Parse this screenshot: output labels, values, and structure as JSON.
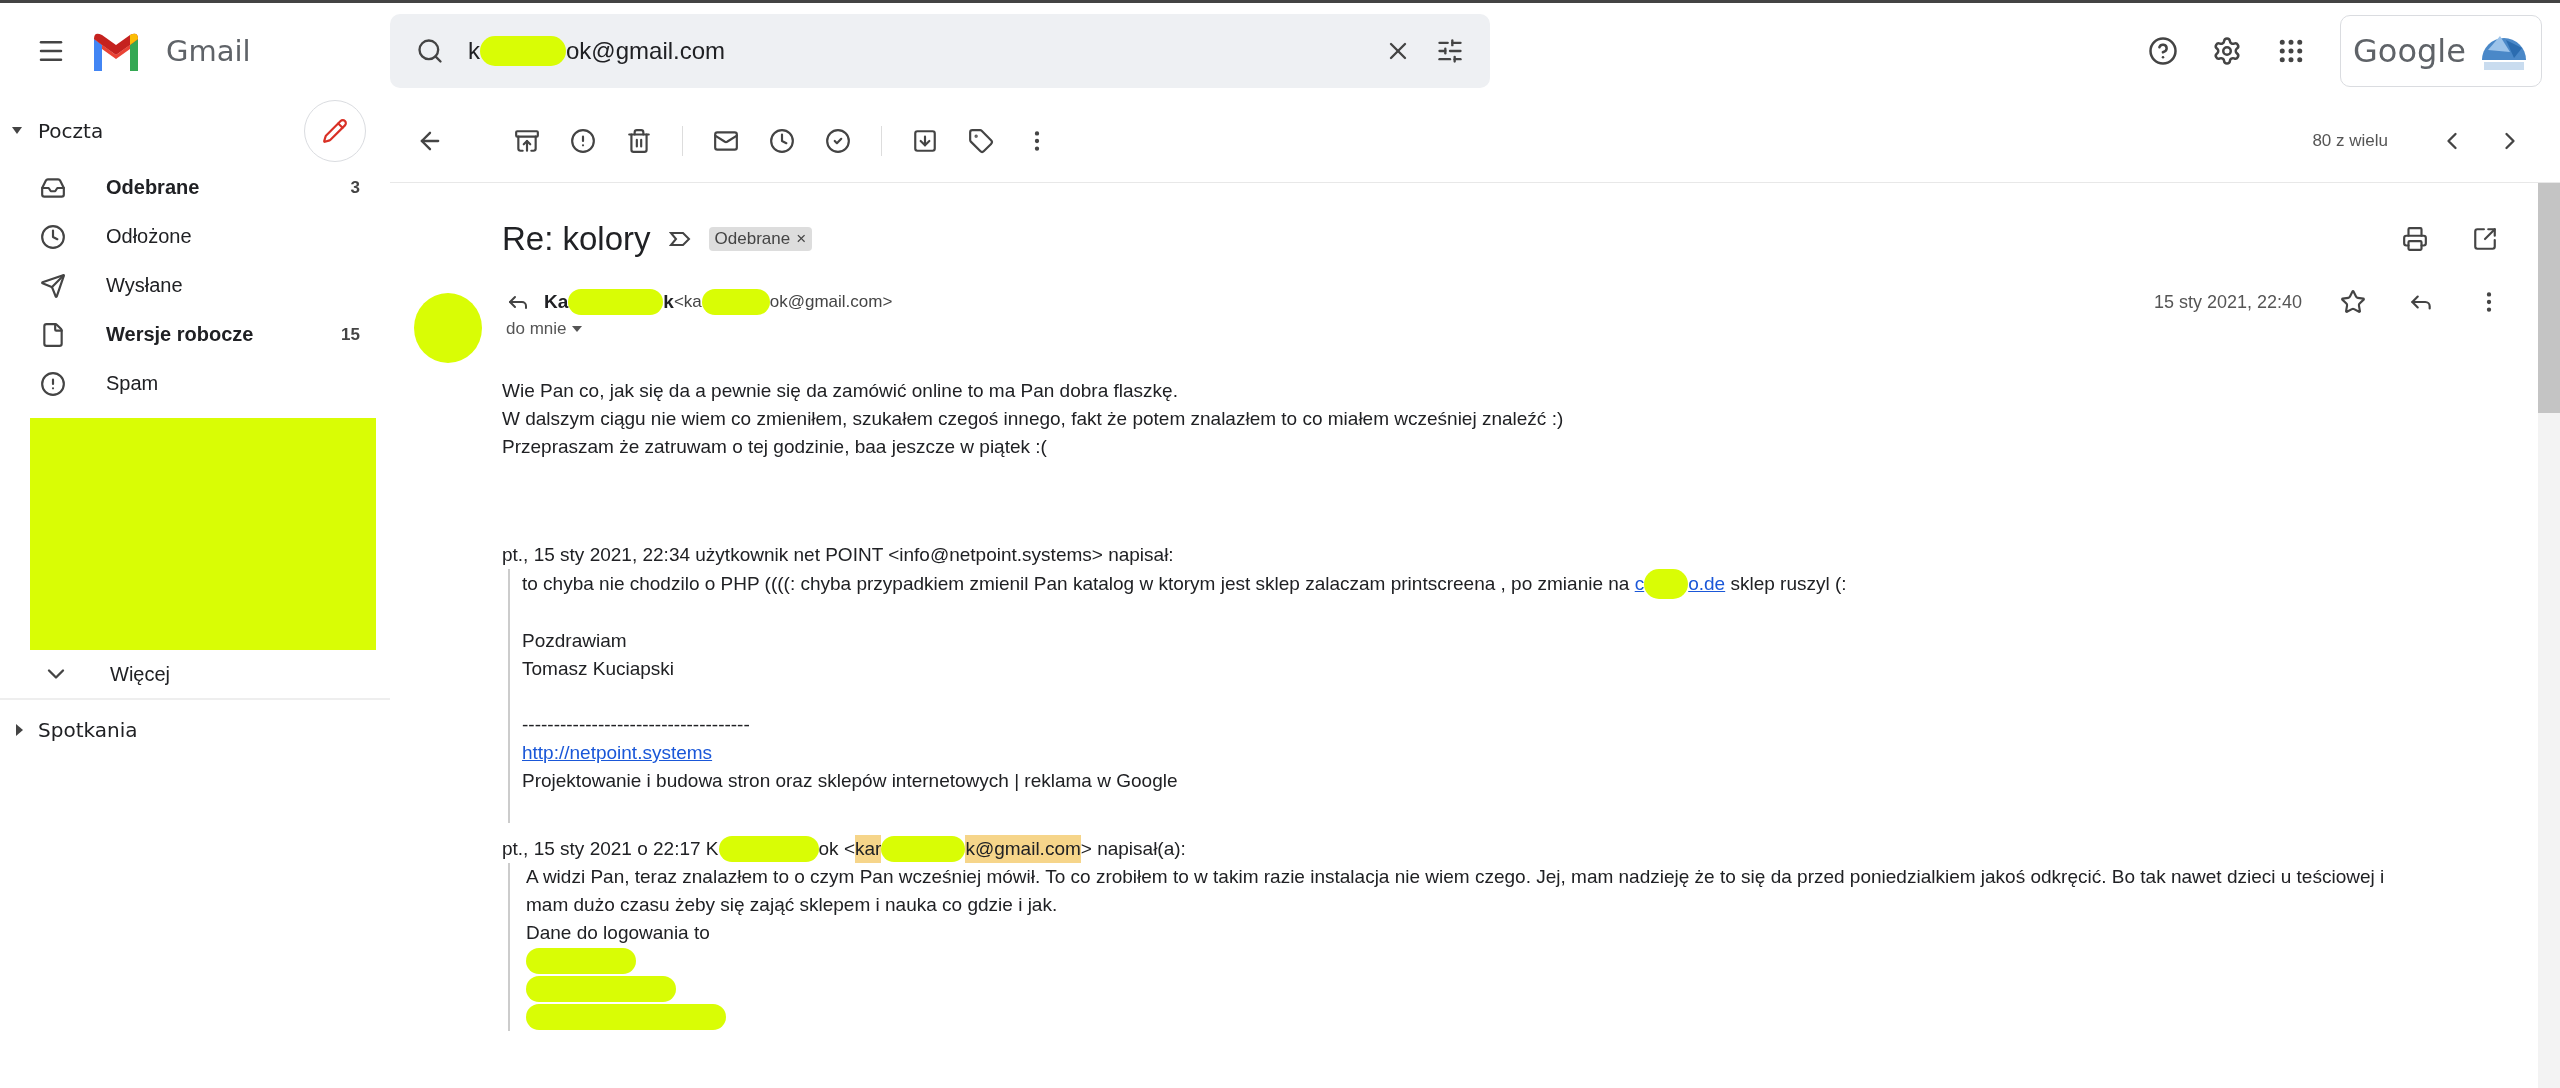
{
  "app": {
    "name": "Gmail"
  },
  "search": {
    "value": [
      {
        "kind": "text",
        "text": "k"
      },
      {
        "kind": "redacted"
      },
      {
        "kind": "text",
        "text": "ok@gmail.com"
      }
    ]
  },
  "account": {
    "label": "Google"
  },
  "sidebar": {
    "section": "Poczta",
    "items": [
      {
        "label": "Odebrane",
        "count": "3",
        "bold": true
      },
      {
        "label": "Odłożone",
        "bold": false
      },
      {
        "label": "Wysłane",
        "bold": false
      },
      {
        "label": "Wersje robocze",
        "count": "15",
        "bold": true
      },
      {
        "label": "Spam",
        "bold": false
      }
    ],
    "more": "Więcej",
    "meetings": "Spotkania"
  },
  "toolbar": {
    "counter": "80 z wielu"
  },
  "message": {
    "subject": "Re: kolory",
    "chip": "Odebrane",
    "chip_close": "×",
    "sender": [
      {
        "kind": "bold",
        "text": "Ka"
      },
      {
        "kind": "redacted"
      },
      {
        "kind": "bold",
        "text": "k"
      },
      {
        "kind": "small",
        "text": " <ka"
      },
      {
        "kind": "redacted"
      },
      {
        "kind": "small",
        "text": "ok@gmail.com>"
      }
    ],
    "recipient": "do mnie",
    "date": "15 sty 2021, 22:40",
    "body": [
      "Wie Pan co, jak się da a pewnie się da zamówić online to ma Pan dobra flaszkę.",
      "W dalszym ciągu nie wiem co zmieniłem, szukałem czegoś innego, fakt że potem znalazłem to co miałem wcześniej znaleźć :)",
      "Przepraszam że zatruwam o tej godzinie, baa jeszcze w piątek :("
    ],
    "quotes": [
      {
        "header": [
          {
            "kind": "text",
            "text": "pt., 15 sty 2021, 22:34 użytkownik net POINT <info@netpoint.systems> napisał:"
          }
        ],
        "lines": [
          [
            {
              "kind": "text",
              "text": "to chyba nie chodzilo o PHP ((((: chyba przypadkiem zmienil Pan katalog w ktorym jest sklep zalaczam printscreena , po zmianie na "
            },
            {
              "kind": "link",
              "text": "c"
            },
            {
              "kind": "redacted"
            },
            {
              "kind": "link",
              "text": "o.de"
            },
            {
              "kind": "text",
              "text": " sklep ruszyl (:"
            }
          ],
          [
            {
              "kind": "gap"
            }
          ],
          [
            {
              "kind": "text",
              "text": "Pozdrawiam"
            }
          ],
          [
            {
              "kind": "text",
              "text": "Tomasz Kuciapski"
            }
          ],
          [
            {
              "kind": "gap"
            }
          ],
          [
            {
              "kind": "text",
              "text": "------------------------------------"
            }
          ],
          [
            {
              "kind": "link",
              "text": "http://netpoint.systems"
            }
          ],
          [
            {
              "kind": "text",
              "text": "Projektowanie i budowa stron oraz sklepów internetowych | reklama w Google"
            }
          ],
          [
            {
              "kind": "gap"
            }
          ]
        ]
      },
      {
        "header": [
          {
            "kind": "text",
            "text": "pt., 15 sty 2021 o 22:17 K"
          },
          {
            "kind": "redacted"
          },
          {
            "kind": "text",
            "text": "ok <"
          },
          {
            "kind": "highlight",
            "text": "kar"
          },
          {
            "kind": "redacted"
          },
          {
            "kind": "highlight",
            "text": "k@gmail.com"
          },
          {
            "kind": "text",
            "text": "> napisał(a):"
          }
        ],
        "lines": [
          [
            {
              "kind": "paragraph",
              "text": "A widzi Pan, teraz znalazłem to o czym Pan wcześniej mówił. To co zrobiłem to w takim razie instalacja nie wiem czego. Jej, mam nadzieję że to się da przed poniedzialkiem jakoś odkręcić. Bo tak nawet dzieci u teściowej i mam dużo czasu żeby się zająć sklepem i nauka co gdzie i jak."
            }
          ],
          [
            {
              "kind": "text",
              "text": "Dane do logowania to"
            }
          ],
          [
            {
              "kind": "redacted"
            }
          ],
          [
            {
              "kind": "redacted"
            }
          ],
          [
            {
              "kind": "redacted"
            }
          ]
        ]
      }
    ]
  }
}
